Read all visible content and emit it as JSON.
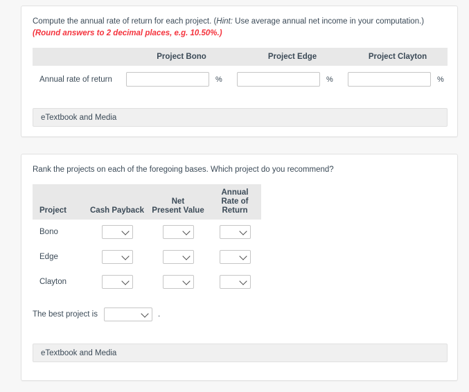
{
  "panel_one": {
    "prompt": {
      "lead": "Compute the annual rate of return for each project. (",
      "hint_label": "Hint:",
      "hint_body": " Use average annual net income in your computation.) ",
      "round_note": "(Round answers to 2 decimal places, e.g. 10.50%.)"
    },
    "table": {
      "headers": [
        "",
        "Project Bono",
        "Project Edge",
        "Project Clayton"
      ],
      "row_label": "Annual rate of return",
      "inputs": [
        {
          "value": "",
          "placeholder": "",
          "suffix": "%"
        },
        {
          "value": "",
          "placeholder": "",
          "suffix": "%"
        },
        {
          "value": "",
          "placeholder": "",
          "suffix": "%"
        }
      ]
    },
    "etextbook_label": "eTextbook and Media"
  },
  "panel_two": {
    "prompt": "Rank the projects on each of the foregoing bases. Which project do you recommend?",
    "table": {
      "headers": [
        {
          "line1": "",
          "line2": "Project"
        },
        {
          "line1": "",
          "line2": "Cash Payback"
        },
        {
          "line1": "Net",
          "line2": "Present Value"
        },
        {
          "line1": "Annual",
          "line2": "Rate of Return"
        }
      ],
      "rows": [
        {
          "project": "Bono",
          "cash_payback": "",
          "net_present_value": "",
          "annual_rate_of_return": ""
        },
        {
          "project": "Edge",
          "cash_payback": "",
          "net_present_value": "",
          "annual_rate_of_return": ""
        },
        {
          "project": "Clayton",
          "cash_payback": "",
          "net_present_value": "",
          "annual_rate_of_return": ""
        }
      ]
    },
    "best_project": {
      "label": "The best project is",
      "value": "",
      "period": "."
    },
    "etextbook_label": "eTextbook and Media"
  },
  "colors": {
    "accent_red": "#f4333d",
    "text": "#3b4a57",
    "header_band": "#e8e8e8",
    "etextbook_band": "#f0f0f0",
    "page_background": "#f7f7f7"
  }
}
